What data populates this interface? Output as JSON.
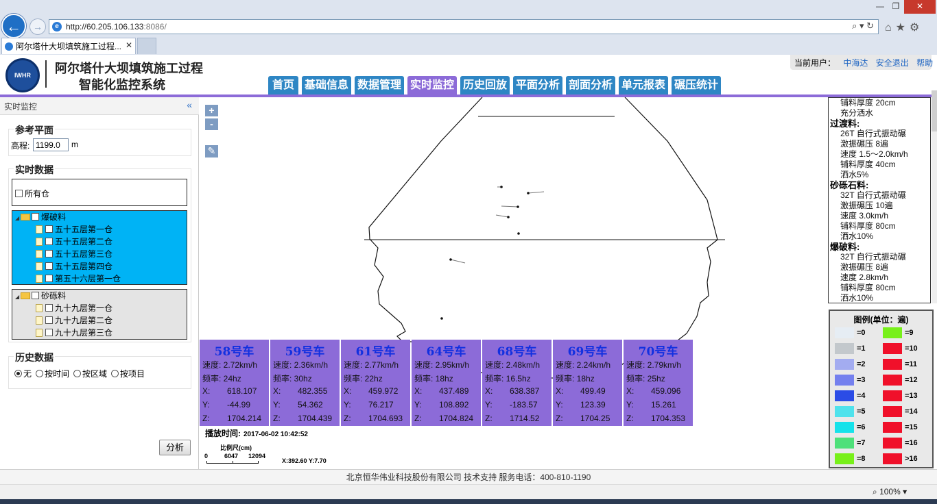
{
  "browser": {
    "url_host": "http://60.205.106.133",
    "url_port": ":8086/",
    "tab_title": "阿尔塔什大坝填筑施工过程...",
    "zoom": "100%"
  },
  "header": {
    "logo_text": "IWHR",
    "title_line1": "阿尔塔什大坝填筑施工过程",
    "title_line2": "智能化监控系统",
    "user_label": "当前用户：",
    "user_name": "中海达",
    "logout": "安全退出",
    "help": "帮助"
  },
  "nav": [
    "首页",
    "基础信息",
    "数据管理",
    "实时监控",
    "历史回放",
    "平面分析",
    "剖面分析",
    "单元报表",
    "碾压统计"
  ],
  "nav_active": "实时监控",
  "left": {
    "panel_title": "实时监控",
    "ref_plane": "参考平面",
    "elev_label": "高程:",
    "elev_value": "1199.0",
    "elev_unit": "m",
    "realtime": "实时数据",
    "all_cang": "所有仓",
    "group1": "爆破料",
    "group1_items": [
      "五十五层第一仓",
      "五十五层第二仓",
      "五十五层第三仓",
      "五十五层第四仓",
      "第五十六层第一仓"
    ],
    "group2": "砂砾料",
    "group2_items": [
      "九十九层第一仓",
      "九十九层第二仓",
      "九十九层第三仓"
    ],
    "history": "历史数据",
    "history_options": [
      "无",
      "按时间",
      "按区域",
      "按项目"
    ],
    "analyze": "分析"
  },
  "cars": [
    {
      "name": "58号车",
      "speed": "速度: 2.72km/h",
      "freq": "频率: 24hz",
      "x": "618.107",
      "y": "-44.99",
      "z": "1704.214"
    },
    {
      "name": "59号车",
      "speed": "速度: 2.36km/h",
      "freq": "频率: 30hz",
      "x": "482.355",
      "y": "54.362",
      "z": "1704.439"
    },
    {
      "name": "61号车",
      "speed": "速度: 2.77km/h",
      "freq": "频率: 22hz",
      "x": "459.972",
      "y": "76.217",
      "z": "1704.693"
    },
    {
      "name": "64号车",
      "speed": "速度: 2.95km/h",
      "freq": "频率: 18hz",
      "x": "437.489",
      "y": "108.892",
      "z": "1704.824"
    },
    {
      "name": "68号车",
      "speed": "速度: 2.48km/h",
      "freq": "频率: 16.5hz",
      "x": "638.387",
      "y": "-183.57",
      "z": "1714.52"
    },
    {
      "name": "69号车",
      "speed": "速度: 2.24km/h",
      "freq": "频率: 18hz",
      "x": "499.49",
      "y": "123.39",
      "z": "1704.25"
    },
    {
      "name": "70号车",
      "speed": "速度: 2.79km/h",
      "freq": "频率: 25hz",
      "x": "459.096",
      "y": "15.261",
      "z": "1704.353"
    }
  ],
  "axis_labels": {
    "x": "X:",
    "y": "Y:",
    "z": "Z:"
  },
  "playback": {
    "label": "播放时间:",
    "time": "2017-06-02 10:42:52"
  },
  "scale": {
    "label": "比例尺(cm)",
    "v0": "0",
    "v1": "6047",
    "v2": "12094"
  },
  "coords": "X:392.60 Y:7.70",
  "materials": {
    "top_items": [
      "铺料厚度 20cm",
      "充分洒水"
    ],
    "sections": [
      {
        "title": "过渡料:",
        "items": [
          "26T 自行式振动碾",
          "激振碾压 8遍",
          "速度 1.5～2.0km/h",
          "铺料厚度 40cm",
          "洒水5%"
        ]
      },
      {
        "title": "砂砾石料:",
        "items": [
          "32T 自行式振动碾",
          "激振碾压 10遍",
          "速度 3.0km/h",
          "铺料厚度 80cm",
          "洒水10%"
        ]
      },
      {
        "title": "爆破料:",
        "items": [
          "32T 自行式振动碾",
          "激振碾压 8遍",
          "速度 2.8km/h",
          "铺料厚度 80cm",
          "洒水10%"
        ]
      }
    ]
  },
  "legend": {
    "title": "图例(单位：遍)",
    "left": [
      {
        "label": "=0",
        "color": "#e6edf4"
      },
      {
        "label": "=1",
        "color": "#c3c8cc"
      },
      {
        "label": "=2",
        "color": "#a3acf0"
      },
      {
        "label": "=3",
        "color": "#7480ee"
      },
      {
        "label": "=4",
        "color": "#2b4ce6"
      },
      {
        "label": "=5",
        "color": "#4fe2ec"
      },
      {
        "label": "=6",
        "color": "#16e2ea"
      },
      {
        "label": "=7",
        "color": "#4ee07a"
      },
      {
        "label": "=8",
        "color": "#78f01a"
      }
    ],
    "right": [
      {
        "label": "=9",
        "color": "#78f01a"
      },
      {
        "label": "=10",
        "color": "#f0102a"
      },
      {
        "label": "=11",
        "color": "#f0102a"
      },
      {
        "label": "=12",
        "color": "#f0102a"
      },
      {
        "label": "=13",
        "color": "#f0102a"
      },
      {
        "label": "=14",
        "color": "#f0102a"
      },
      {
        "label": "=15",
        "color": "#f0102a"
      },
      {
        "label": "=16",
        "color": "#f0102a"
      },
      {
        "label": ">16",
        "color": "#f0102a"
      }
    ]
  },
  "footer": "北京恒华伟业科技股份有限公司 技术支持  服务电话：400-810-1190"
}
